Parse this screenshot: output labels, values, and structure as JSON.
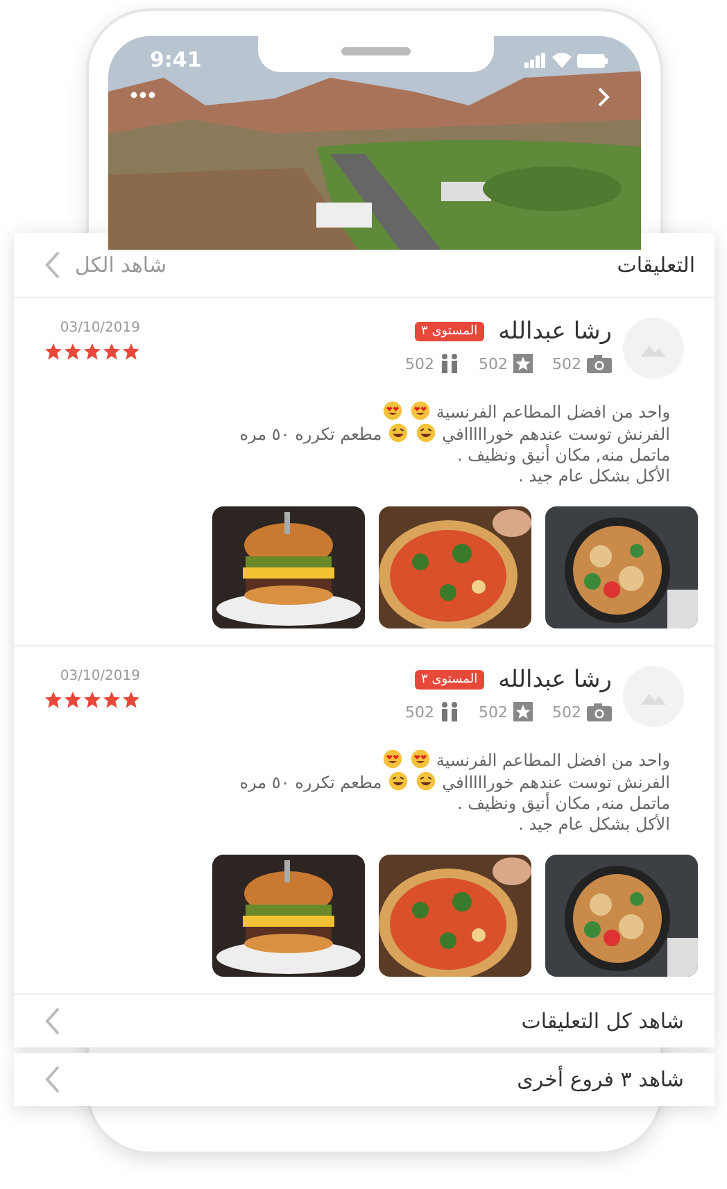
{
  "status_bar": {
    "time": "9:41"
  },
  "header_photo": {
    "kind": "picture"
  },
  "comments": {
    "title": "التعليقات",
    "see_all": "شاهد الكل"
  },
  "reviews": [
    {
      "name": "رشا عبدالله",
      "badge": "المستوى ٣",
      "stats": [
        {
          "kind": "camera",
          "count": "502"
        },
        {
          "kind": "star",
          "count": "502"
        },
        {
          "kind": "people",
          "count": "502"
        }
      ],
      "date": "03/10/2019",
      "stars": 5,
      "lines": [
        [
          {
            "kind": "text",
            "text": "واحد من افضل المطاعم الفرنسية"
          },
          {
            "kind": "heart-eyes"
          },
          {
            "kind": "heart-eyes"
          }
        ],
        [
          {
            "kind": "text",
            "text": "الفرنش توست عندهم خورااااافي"
          },
          {
            "kind": "laughing"
          },
          {
            "kind": "laughing"
          },
          {
            "kind": "text",
            "text": "مطعم تكرره ٥٠ مره"
          }
        ],
        [
          {
            "kind": "text",
            "text": "ماتمل منه, مكان أنيق ونظيف ."
          }
        ],
        [
          {
            "kind": "text",
            "text": "الأكل بشكل عام جيد ."
          }
        ]
      ],
      "photos": [
        {
          "kind": "picture"
        },
        {
          "kind": "picture"
        },
        {
          "kind": "picture"
        }
      ]
    },
    {
      "name": "رشا عبدالله",
      "badge": "المستوى ٣",
      "stats": [
        {
          "kind": "camera",
          "count": "502"
        },
        {
          "kind": "star",
          "count": "502"
        },
        {
          "kind": "people",
          "count": "502"
        }
      ],
      "date": "03/10/2019",
      "stars": 5,
      "lines": [
        [
          {
            "kind": "text",
            "text": "واحد من افضل المطاعم الفرنسية"
          },
          {
            "kind": "heart-eyes"
          },
          {
            "kind": "heart-eyes"
          }
        ],
        [
          {
            "kind": "text",
            "text": "الفرنش توست عندهم خورااااافي"
          },
          {
            "kind": "laughing"
          },
          {
            "kind": "laughing"
          },
          {
            "kind": "text",
            "text": "مطعم تكرره ٥٠ مره"
          }
        ],
        [
          {
            "kind": "text",
            "text": "ماتمل منه, مكان أنيق ونظيف ."
          }
        ],
        [
          {
            "kind": "text",
            "text": "الأكل بشكل عام جيد ."
          }
        ]
      ],
      "photos": [
        {
          "kind": "picture"
        },
        {
          "kind": "picture"
        },
        {
          "kind": "picture"
        }
      ]
    }
  ],
  "see_all_comments": "شاهد كل التعليقات",
  "other_branches": "شاهد ٣ فروع أخرى"
}
